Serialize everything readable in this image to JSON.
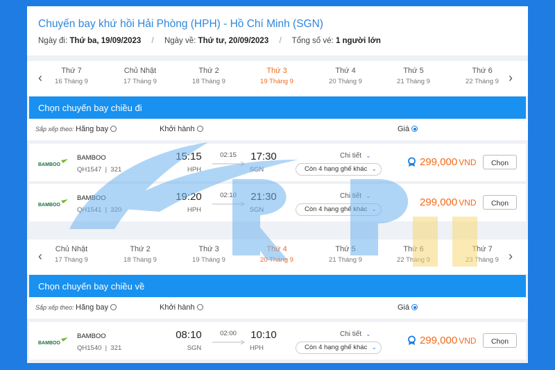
{
  "header": {
    "title": "Chuyến bay khứ hồi Hải Phòng (HPH) - Hồ Chí Minh (SGN)",
    "depart_label": "Ngày đi:",
    "depart_value": "Thứ ba, 19/09/2023",
    "return_label": "Ngày về:",
    "return_value": "Thứ tư, 20/09/2023",
    "tickets_label": "Tổng số vé:",
    "tickets_value": "1 người lớn"
  },
  "outbound_dates": [
    {
      "day": "Thứ 7",
      "date": "16 Tháng 9"
    },
    {
      "day": "Chủ Nhật",
      "date": "17 Tháng 9"
    },
    {
      "day": "Thứ 2",
      "date": "18 Tháng 9"
    },
    {
      "day": "Thứ 3",
      "date": "19 Tháng 9",
      "active": true
    },
    {
      "day": "Thứ 4",
      "date": "20 Tháng 9"
    },
    {
      "day": "Thứ 5",
      "date": "21 Tháng 9"
    },
    {
      "day": "Thứ 6",
      "date": "22 Tháng 9"
    }
  ],
  "return_dates": [
    {
      "day": "Chủ Nhật",
      "date": "17 Tháng 9"
    },
    {
      "day": "Thứ 2",
      "date": "18 Tháng 9"
    },
    {
      "day": "Thứ 3",
      "date": "19 Tháng 9"
    },
    {
      "day": "Thứ 4",
      "date": "20 Tháng 9",
      "active": true
    },
    {
      "day": "Thứ 5",
      "date": "21 Tháng 9"
    },
    {
      "day": "Thứ 6",
      "date": "22 Tháng 9"
    },
    {
      "day": "Thứ 7",
      "date": "23 Tháng 9"
    }
  ],
  "outbound": {
    "section_title": "Chọn chuyến bay chiều đi",
    "sort": {
      "label": "Sắp xếp theo:",
      "airline": "Hãng bay",
      "departure": "Khởi hành",
      "price": "Giá"
    },
    "flights": [
      {
        "airline": "BAMBOO",
        "code": "QH1547",
        "aircraft": "321",
        "dep_time": "15:15",
        "dep_airport": "HPH",
        "duration": "02:15",
        "arr_time": "17:30",
        "arr_airport": "SGN",
        "details": "Chi tiết",
        "seats": "Còn 4 hạng ghế khác",
        "price": "299,000",
        "currency": "VND",
        "choose": "Chọn"
      },
      {
        "airline": "BAMBOO",
        "code": "QH1541",
        "aircraft": "320",
        "dep_time": "19:20",
        "dep_airport": "HPH",
        "duration": "02:10",
        "arr_time": "21:30",
        "arr_airport": "SGN",
        "details": "Chi tiết",
        "seats": "Còn 4 hạng ghế khác",
        "price": "299,000",
        "currency": "VND",
        "choose": "Chọn"
      }
    ]
  },
  "inbound": {
    "section_title": "Chọn chuyến bay chiều về",
    "sort": {
      "label": "Sắp xếp theo:",
      "airline": "Hãng bay",
      "departure": "Khởi hành",
      "price": "Giá"
    },
    "flights": [
      {
        "airline": "BAMBOO",
        "code": "QH1540",
        "aircraft": "321",
        "dep_time": "08:10",
        "dep_airport": "SGN",
        "duration": "02:00",
        "arr_time": "10:10",
        "arr_airport": "HPH",
        "details": "Chi tiết",
        "seats": "Còn 4 hạng ghế khác",
        "price": "299,000",
        "currency": "VND",
        "choose": "Chọn"
      }
    ]
  },
  "colors": {
    "accent": "#1891f0",
    "price": "#f26a1b",
    "title": "#2f86dc"
  }
}
